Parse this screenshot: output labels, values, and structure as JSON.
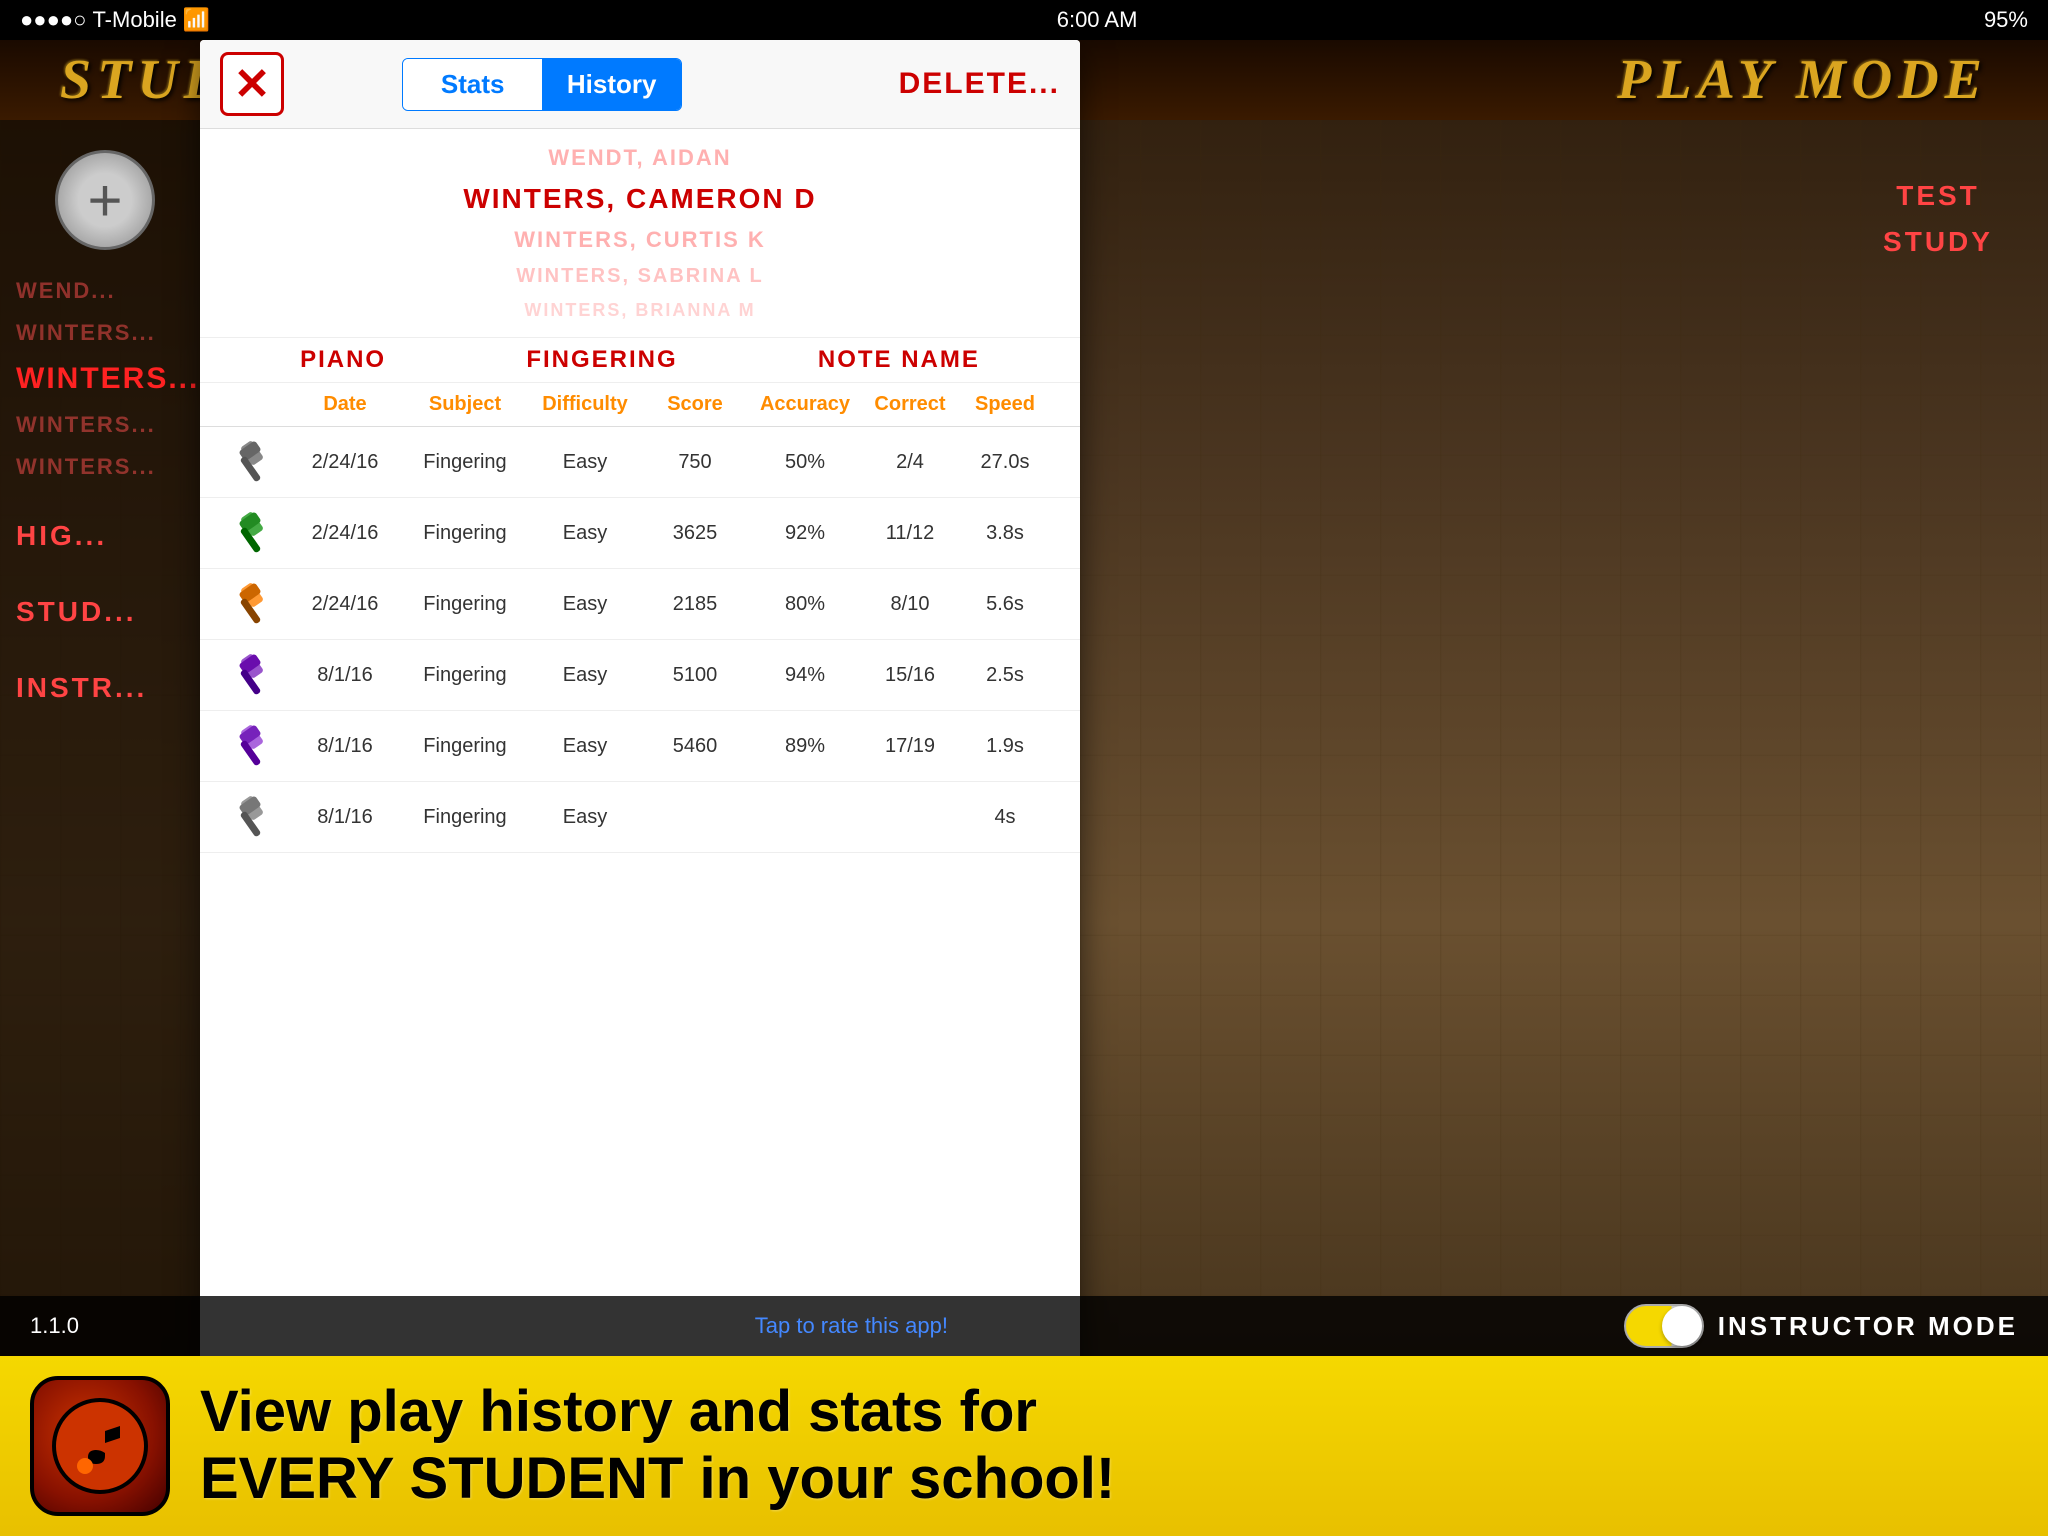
{
  "statusBar": {
    "carrier": "T-Mobile",
    "signal": "●●●●○",
    "time": "6:00 AM",
    "battery": "95%"
  },
  "header": {
    "leftTitle": "STUDENTS",
    "rightTitle": "PLAY MODE"
  },
  "sidebar": {
    "addButton": "+",
    "students": [
      {
        "name": "WEND...",
        "state": "faded"
      },
      {
        "name": "WINTERS...",
        "state": "faded"
      },
      {
        "name": "WINTERS...",
        "state": "selected"
      },
      {
        "name": "WINTERS...",
        "state": "faded"
      },
      {
        "name": "WINTERS...",
        "state": "faded"
      }
    ],
    "sections": [
      {
        "label": "HIG..."
      },
      {
        "label": "STUD..."
      },
      {
        "label": "INSTR..."
      }
    ]
  },
  "rightLabels": [
    {
      "label": "TEST"
    },
    {
      "label": "STUDY"
    }
  ],
  "modal": {
    "closeButton": "X",
    "tabs": [
      {
        "label": "Stats",
        "active": false
      },
      {
        "label": "History",
        "active": true
      }
    ],
    "deleteButton": "DELETE...",
    "title": "Stats History",
    "studentList": [
      {
        "name": "WENDT, AIDAN",
        "state": "faded"
      },
      {
        "name": "WINTERS, CAMERON D",
        "state": "selected"
      },
      {
        "name": "WINTERS, CURTIS K",
        "state": "faded"
      },
      {
        "name": "WINTERS, SABRINA L",
        "state": "faded"
      },
      {
        "name": "WINTERS, BRIANNA M",
        "state": "faded"
      }
    ],
    "subjects": [
      {
        "label": "PIANO"
      },
      {
        "label": "FINGERING"
      },
      {
        "label": "NOTE NAME"
      }
    ],
    "tableHeaders": [
      {
        "label": ""
      },
      {
        "label": "Date"
      },
      {
        "label": "Subject"
      },
      {
        "label": "Difficulty"
      },
      {
        "label": "Score"
      },
      {
        "label": "Accuracy"
      },
      {
        "label": "Correct"
      },
      {
        "label": "Speed"
      }
    ],
    "tableRows": [
      {
        "iconColor": "grey",
        "date": "2/24/16",
        "subject": "Fingering",
        "difficulty": "Easy",
        "score": "750",
        "accuracy": "50%",
        "correct": "2/4",
        "speed": "27.0s"
      },
      {
        "iconColor": "green",
        "date": "2/24/16",
        "subject": "Fingering",
        "difficulty": "Easy",
        "score": "3625",
        "accuracy": "92%",
        "correct": "11/12",
        "speed": "3.8s"
      },
      {
        "iconColor": "orange",
        "date": "2/24/16",
        "subject": "Fingering",
        "difficulty": "Easy",
        "score": "2185",
        "accuracy": "80%",
        "correct": "8/10",
        "speed": "5.6s"
      },
      {
        "iconColor": "purple",
        "date": "8/1/16",
        "subject": "Fingering",
        "difficulty": "Easy",
        "score": "5100",
        "accuracy": "94%",
        "correct": "15/16",
        "speed": "2.5s"
      },
      {
        "iconColor": "purple2",
        "date": "8/1/16",
        "subject": "Fingering",
        "difficulty": "Easy",
        "score": "5460",
        "accuracy": "89%",
        "correct": "17/19",
        "speed": "1.9s"
      },
      {
        "iconColor": "grey",
        "date": "8/1/16",
        "subject": "Fingering",
        "difficulty": "Easy",
        "score": "...",
        "accuracy": "...",
        "correct": "...",
        "speed": "4s"
      }
    ]
  },
  "banner": {
    "text1": "View play history and stats for",
    "text2": "EVERY STUDENT in your school!"
  },
  "bottomBar": {
    "version": "1.1.0",
    "rateText": "Tap to rate this app!",
    "instructorLabel": "INSTRUCTOR MODE"
  },
  "colors": {
    "accent": "#FF4444",
    "orange": "#FF8C00",
    "blue": "#007AFF",
    "banner": "#F5D800"
  }
}
